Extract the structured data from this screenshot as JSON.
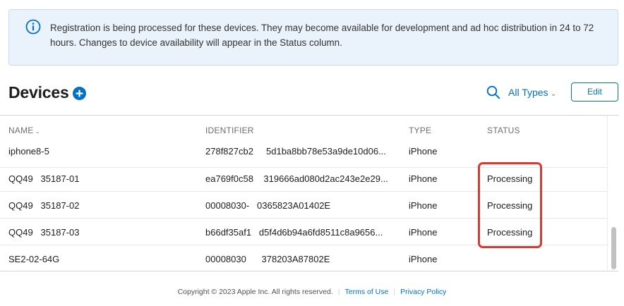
{
  "banner": {
    "icon": "info-icon",
    "message": "Registration is being processed for these devices. They may become available for development and ad hoc distribution in 24 to 72 hours. Changes to device availability will appear in the Status column."
  },
  "header": {
    "title": "Devices",
    "add_icon": "plus-circle-icon",
    "search_icon": "search-icon",
    "type_filter": "All Types",
    "edit_label": "Edit"
  },
  "table": {
    "columns": [
      "NAME",
      "IDENTIFIER",
      "TYPE",
      "STATUS"
    ],
    "rows": [
      {
        "name": "iphone8-5",
        "identifier": "278f827cb2     5d1ba8bb78e53a9de10d06...",
        "type": "iPhone",
        "status": ""
      },
      {
        "name": "QQ49   35187-01",
        "identifier": "ea769f0c58    319666ad080d2ac243e2e29...",
        "type": "iPhone",
        "status": "Processing"
      },
      {
        "name": "QQ49   35187-02",
        "identifier": "00008030-   0365823A01402E",
        "type": "iPhone",
        "status": "Processing"
      },
      {
        "name": "QQ49   35187-03",
        "identifier": "b66df35af1   d5f4d6b94a6fd8511c8a9656...",
        "type": "iPhone",
        "status": "Processing"
      },
      {
        "name": "SE2-02-64G",
        "identifier": "00008030      378203A87802E",
        "type": "iPhone",
        "status": ""
      }
    ]
  },
  "footer": {
    "copyright": "Copyright © 2023 Apple Inc. All rights reserved.",
    "terms": "Terms of Use",
    "privacy": "Privacy Policy"
  },
  "colors": {
    "accent": "#0070c9",
    "highlight": "#e8332b",
    "banner_bg": "#eaf2fb"
  }
}
